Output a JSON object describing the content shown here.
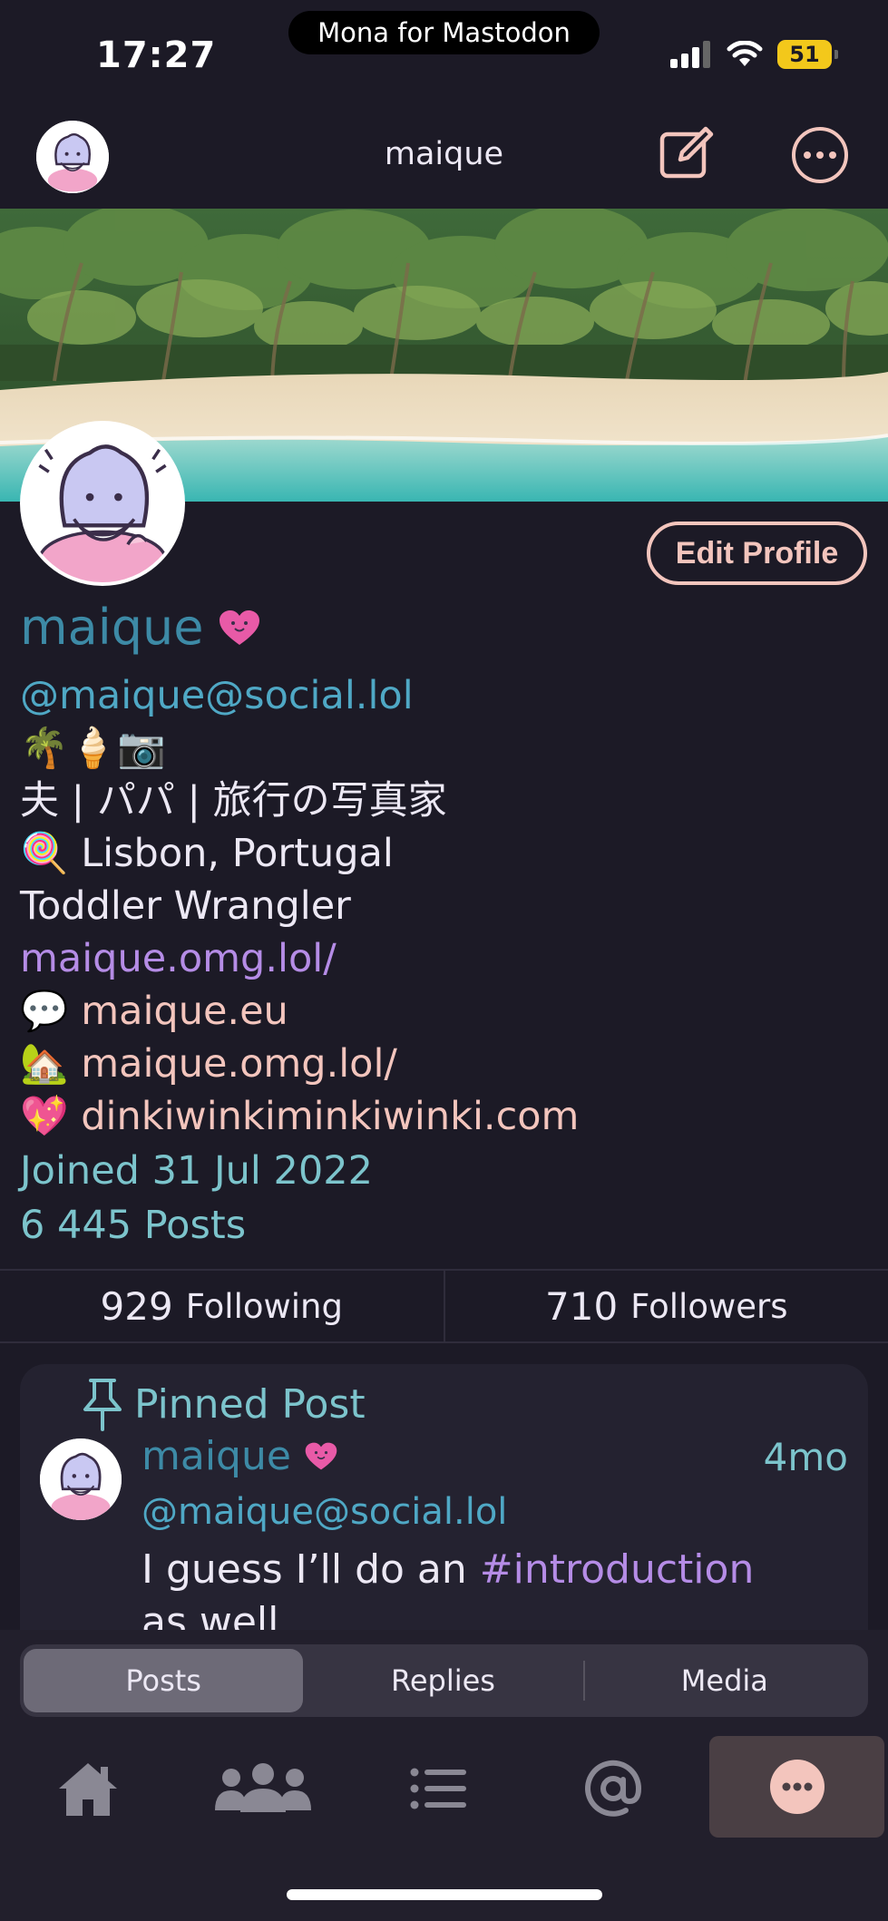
{
  "status_bar": {
    "time": "17:27",
    "app_name": "Mona for Mastodon",
    "battery": "51"
  },
  "nav": {
    "title": "maique",
    "compose_icon": "compose-icon",
    "more_icon": "more-icon"
  },
  "profile": {
    "edit_label": "Edit Profile",
    "display_name": "maique",
    "handle": "@maique@social.lol",
    "bio_emoji_line": "🌴🍦📷",
    "bio_jp": "夫 | パパ | 旅行の写真家",
    "location_emoji": "🍭",
    "location": "Lisbon, Portugal",
    "tagline": "Toddler Wrangler",
    "link_main": "maique.omg.lol/",
    "links": [
      {
        "emoji": "💬",
        "text": "maique.eu"
      },
      {
        "emoji": "🏡",
        "text": "maique.omg.lol/"
      },
      {
        "emoji": "💖",
        "text": "dinkiwinkiminkiwinki.com"
      }
    ],
    "joined": "Joined 31 Jul 2022",
    "posts_count": "6 445 Posts"
  },
  "stats": {
    "following_num": "929",
    "following_label": "Following",
    "followers_num": "710",
    "followers_label": "Followers"
  },
  "pinned_post": {
    "label": "Pinned Post",
    "author": "maique",
    "time": "4mo",
    "handle": "@maique@social.lol",
    "text_prefix": "I guess I’ll do an ",
    "hashtag": "#introduction",
    "text_cont": "as well…"
  },
  "segments": [
    {
      "label": "Posts",
      "active": true
    },
    {
      "label": "Replies",
      "active": false
    },
    {
      "label": "Media",
      "active": false
    }
  ],
  "tabbar": [
    "home-icon",
    "people-icon",
    "list-icon",
    "mention-icon",
    "more-icon"
  ],
  "colors": {
    "background": "#1c1a26",
    "accent_peach": "#f3c5bd",
    "name_blue": "#3d8aa6",
    "teal": "#7cc4cc",
    "link_purple": "#b58ce6"
  }
}
